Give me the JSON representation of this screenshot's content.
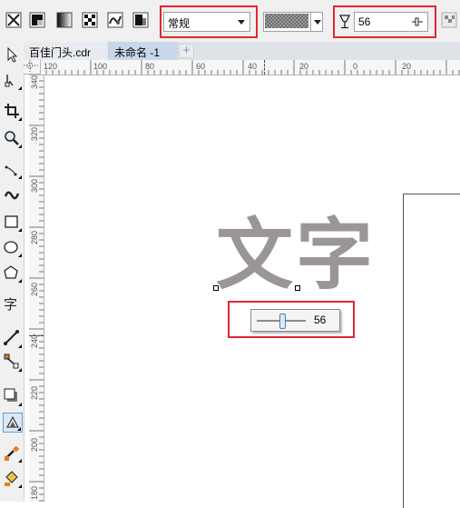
{
  "propbar": {
    "style_select": {
      "value": "常规"
    },
    "opacity_field": {
      "value": "56"
    }
  },
  "tabs": [
    {
      "label": "百佳门头.cdr"
    },
    {
      "label": "未命名 -1"
    }
  ],
  "ruler": {
    "h_labels": [
      "120",
      "100",
      "80",
      "60",
      "40",
      "20",
      "0",
      "20"
    ],
    "v_labels": [
      "340",
      "320",
      "300",
      "280",
      "260",
      "240",
      "220",
      "200",
      "180"
    ]
  },
  "canvas": {
    "text": "文字"
  },
  "opacity_popup": {
    "value": "56"
  },
  "colors": {
    "highlight": "#e0272f",
    "text_fill": "#9a9695"
  }
}
